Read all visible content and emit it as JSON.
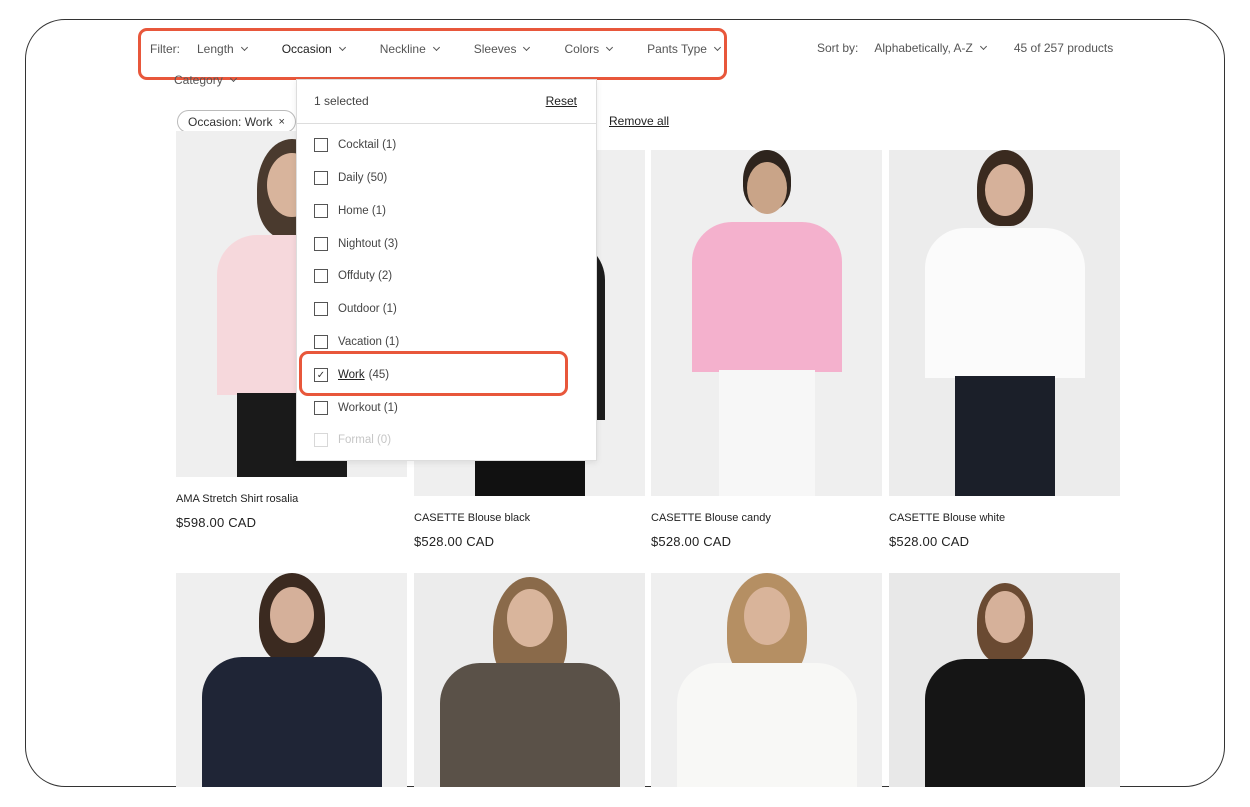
{
  "filter": {
    "label": "Filter:",
    "facets": [
      {
        "label": "Length"
      },
      {
        "label": "Occasion"
      },
      {
        "label": "Neckline"
      },
      {
        "label": "Sleeves"
      },
      {
        "label": "Colors"
      },
      {
        "label": "Pants Type"
      }
    ],
    "category_label": "Category"
  },
  "sort": {
    "label": "Sort by:",
    "value": "Alphabetically, A-Z",
    "count": "45 of 257 products"
  },
  "active_filters": {
    "chip_label": "Occasion: Work",
    "chip_close": "×",
    "remove_all": "Remove all"
  },
  "dropdown": {
    "selected_text": "1 selected",
    "reset_label": "Reset",
    "options": [
      {
        "label": "Cocktail (1)",
        "checked": false,
        "disabled": false
      },
      {
        "label": "Daily (50)",
        "checked": false,
        "disabled": false
      },
      {
        "label": "Home (1)",
        "checked": false,
        "disabled": false
      },
      {
        "label": "Nightout (3)",
        "checked": false,
        "disabled": false
      },
      {
        "label": "Offduty (2)",
        "checked": false,
        "disabled": false
      },
      {
        "label": "Outdoor (1)",
        "checked": false,
        "disabled": false
      },
      {
        "label": "Vacation (1)",
        "checked": false,
        "disabled": false
      },
      {
        "label": "Work",
        "count": "(45)",
        "checked": true,
        "disabled": false
      },
      {
        "label": "Workout (1)",
        "checked": false,
        "disabled": false
      },
      {
        "label": "Formal (0)",
        "checked": false,
        "disabled": true
      }
    ]
  },
  "products": [
    {
      "title": "AMA Stretch Shirt rosalia",
      "price": "$598.00 CAD"
    },
    {
      "title": "CASETTE Blouse black",
      "price": "$528.00 CAD"
    },
    {
      "title": "CASETTE Blouse candy",
      "price": "$528.00 CAD"
    },
    {
      "title": "CASETTE Blouse white",
      "price": "$528.00 CAD"
    },
    {
      "title": "",
      "price": ""
    },
    {
      "title": "",
      "price": ""
    },
    {
      "title": "",
      "price": ""
    },
    {
      "title": "",
      "price": ""
    }
  ],
  "colors": {
    "highlight": "#e8573b",
    "text": "#222222",
    "muted": "#555555"
  }
}
